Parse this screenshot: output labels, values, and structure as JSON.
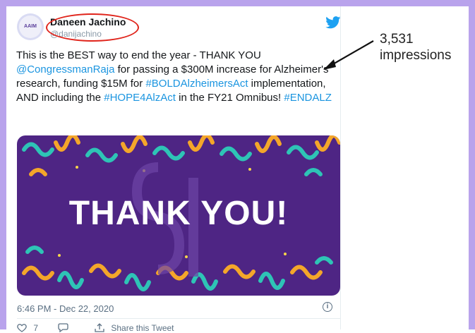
{
  "tweet": {
    "avatar_text": "AAIM",
    "name": "Daneen Jachino",
    "handle": "@danijachino",
    "body": {
      "t1": "This is the BEST way to end the year - THANK YOU ",
      "mention": "@CongressmanRaja",
      "t2": " for passing a $300M increase for Alzheimer's research, funding $15M for ",
      "hashtag1": "#BOLDAlzheimersAct",
      "t3": " implementation, AND including the ",
      "hashtag2": "#HOPE4AlzAct",
      "t4": " in the FY21 Omnibus! ",
      "hashtag3": "#ENDALZ"
    },
    "media_text": "THANK YOU!",
    "timestamp": "6:46 PM - Dec 22, 2020",
    "info_glyph": "i",
    "actions": {
      "like_count": "7",
      "share_label": "Share this Tweet"
    }
  },
  "annotation": {
    "line1": "3,531",
    "line2": "impressions"
  },
  "colors": {
    "frame": "#b9a3ec",
    "link": "#1b95e0",
    "media_bg": "#4e2584",
    "highlight_oval": "#e0241b"
  }
}
